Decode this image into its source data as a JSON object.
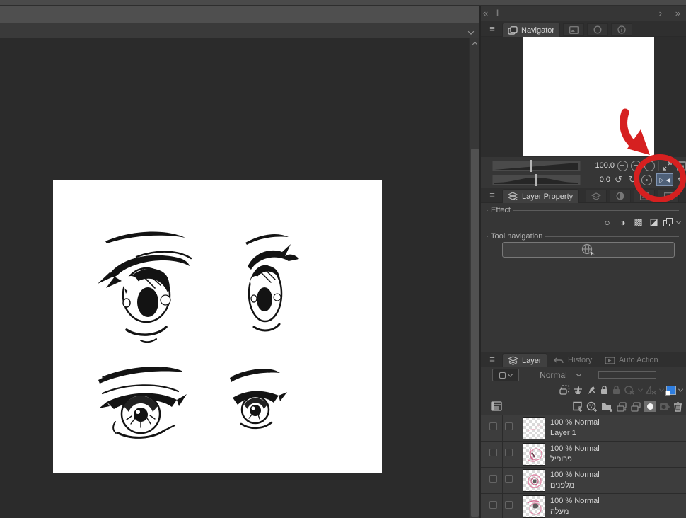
{
  "icons": {
    "menu": "≡",
    "collapse_left": "«",
    "grip": "‖",
    "expand_right": "›",
    "expand_right_end": "»",
    "rotate_ccw": "↺",
    "rotate_cw": "↻",
    "flip_right_tri": "▷",
    "flip_left_tri": "◀",
    "effect_border": "○",
    "effect_tone": "◑",
    "effect_halftone": "▩",
    "effect_extract_line": "◪"
  },
  "navigator": {
    "tab_label": "Navigator",
    "zoom_value": "100.0",
    "rotation_value": "0.0"
  },
  "layer_property": {
    "tab_label": "Layer Property",
    "effect_label": "Effect",
    "tool_navigation_label": "Tool navigation"
  },
  "layer_panel": {
    "tab_layer": "Layer",
    "tab_history": "History",
    "tab_auto_action": "Auto Action",
    "blend_mode": "Normal",
    "layers": [
      {
        "info": "100 % Normal",
        "name": "Layer 1"
      },
      {
        "info": "100 % Normal",
        "name": "פרופיל"
      },
      {
        "info": "100 % Normal",
        "name": "מלפנים"
      },
      {
        "info": "100 % Normal",
        "name": "מעלה"
      }
    ]
  },
  "colors": {
    "annotation_red": "#d62020",
    "flip_active_bg": "#4e6078",
    "layer_color_swatch": "#2f7ee0",
    "canvas_bg": "#2b2b2b",
    "panel_bg": "#363636"
  }
}
